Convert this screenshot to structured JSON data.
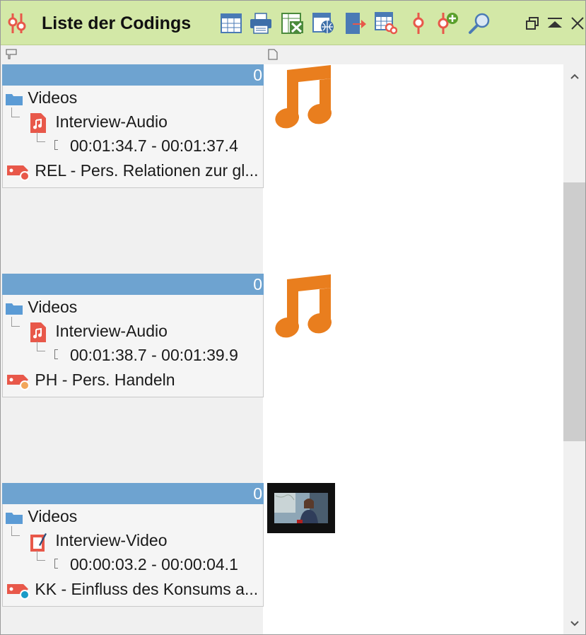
{
  "window": {
    "title": "Liste der Codings"
  },
  "toolbar": {
    "buttons": [
      {
        "name": "table-view-icon",
        "label": ""
      },
      {
        "name": "print-icon",
        "label": ""
      },
      {
        "name": "excel-export-icon",
        "label": ""
      },
      {
        "name": "web-export-icon",
        "label": ""
      },
      {
        "name": "export-document-icon",
        "label": ""
      },
      {
        "name": "table-codes-icon",
        "label": ""
      },
      {
        "name": "code-icon",
        "label": ""
      },
      {
        "name": "add-code-icon",
        "label": ""
      },
      {
        "name": "search-icon",
        "label": ""
      }
    ]
  },
  "window_controls": [
    "restore-icon",
    "collapse-icon",
    "close-icon"
  ],
  "colors": {
    "titlebar": "#d3e8a7",
    "card_header": "#6ea3d0",
    "music_icon": "#e97e1e",
    "doc_icon": "#e8584a",
    "folder_icon": "#5b9bd5"
  },
  "codings": [
    {
      "weight": "0",
      "folder": "Videos",
      "document": "Interview-Audio",
      "document_type": "audio",
      "segment": "00:01:34.7 - 00:01:37.4",
      "code": "REL - Pers. Relationen zur gl...",
      "code_dot_color": "#e8584a",
      "preview": "music-note-icon"
    },
    {
      "weight": "0",
      "folder": "Videos",
      "document": "Interview-Audio",
      "document_type": "audio",
      "segment": "00:01:38.7 - 00:01:39.9",
      "code": "PH - Pers. Handeln",
      "code_dot_color": "#f2a65a",
      "preview": "music-note-icon"
    },
    {
      "weight": "0",
      "folder": "Videos",
      "document": "Interview-Video",
      "document_type": "video",
      "segment": "00:00:03.2 - 00:00:04.1",
      "code": "KK - Einfluss des Konsums a...",
      "code_dot_color": "#1a9bc7",
      "preview": "video-thumbnail"
    }
  ]
}
